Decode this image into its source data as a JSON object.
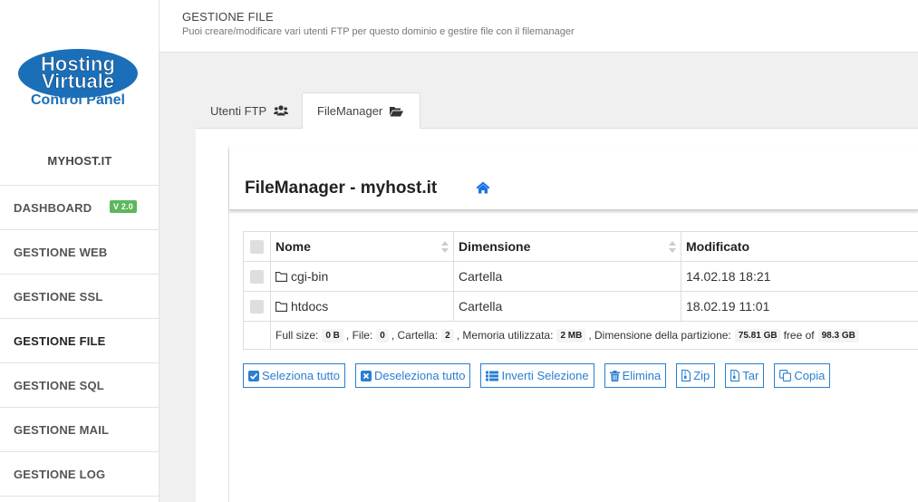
{
  "logo": {
    "line1": "Hosting",
    "line2": "Virtuale",
    "line3": "Control Panel",
    "color": "#1b6fb8"
  },
  "sidebar": {
    "domain": "MYHOST.IT",
    "version_badge": "V 2.0",
    "items": [
      {
        "label": "DASHBOARD"
      },
      {
        "label": "GESTIONE WEB"
      },
      {
        "label": "GESTIONE SSL"
      },
      {
        "label": "GESTIONE FILE"
      },
      {
        "label": "GESTIONE SQL"
      },
      {
        "label": "GESTIONE MAIL"
      },
      {
        "label": "GESTIONE LOG"
      }
    ]
  },
  "header": {
    "title": "GESTIONE FILE",
    "subtitle": "Puoi creare/modificare vari utenti FTP per questo dominio e gestire file con il filemanager"
  },
  "tabs": [
    {
      "label": "Utenti FTP",
      "icon": "users-icon"
    },
    {
      "label": "FileManager",
      "icon": "folder-open-icon",
      "active": true
    }
  ],
  "filemanager": {
    "title": "FileManager - myhost.it",
    "columns": [
      "Nome",
      "Dimensione",
      "Modificato"
    ],
    "rows": [
      {
        "name": "cgi-bin",
        "size": "Cartella",
        "modified": "14.02.18 18:21"
      },
      {
        "name": "htdocs",
        "size": "Cartella",
        "modified": "18.02.19 11:01"
      }
    ],
    "footer": {
      "full_size_label": "Full size:",
      "full_size": "0 B",
      "file_label": ", File:",
      "file": "0",
      "folder_label": ", Cartella:",
      "folder": "2",
      "mem_label": ", Memoria utilizzata:",
      "mem": "2 MB",
      "part_label": ", Dimensione della partizione:",
      "part": "75.81 GB",
      "free_label": "free of",
      "total": "98.3 GB"
    },
    "buttons": {
      "select_all": "Seleziona tutto",
      "deselect_all": "Deseleziona tutto",
      "invert": "Inverti Selezione",
      "delete": "Elimina",
      "zip": "Zip",
      "tar": "Tar",
      "copy": "Copia"
    }
  },
  "colors": {
    "accent": "#2a7fd0",
    "badge": "#5cb85c"
  }
}
